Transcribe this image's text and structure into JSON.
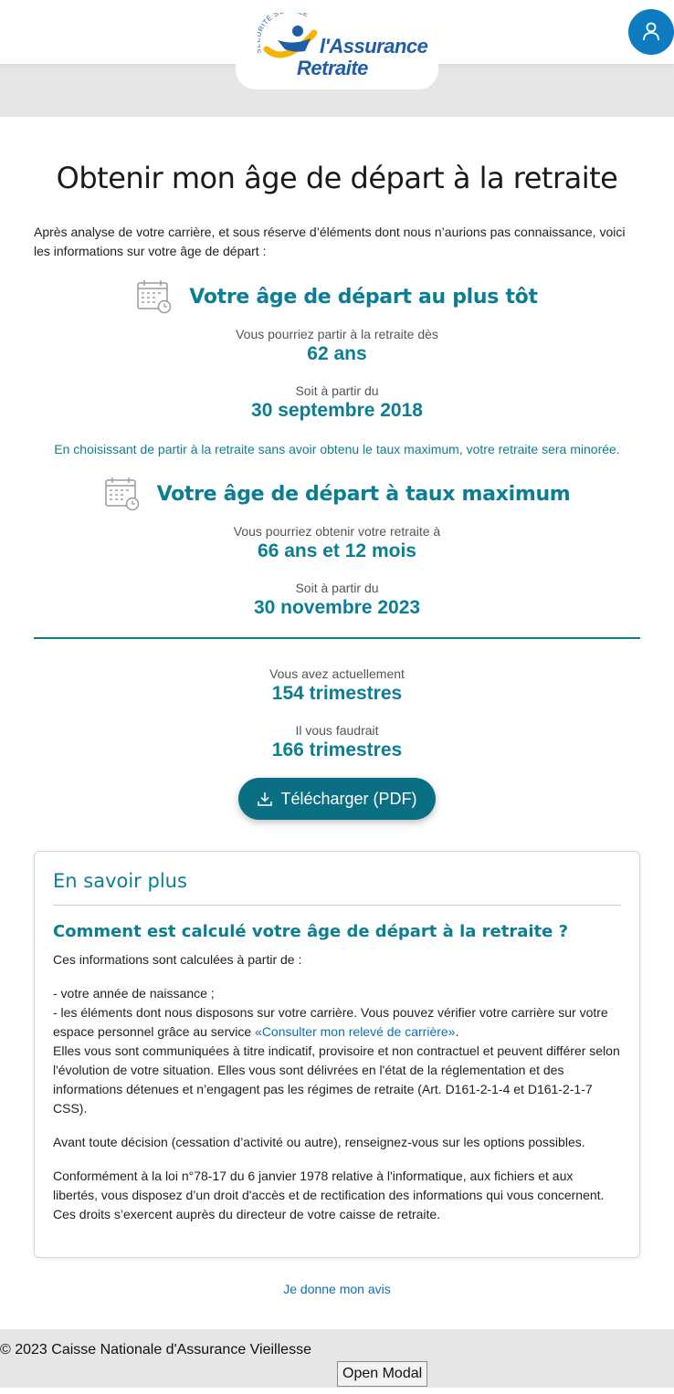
{
  "header": {
    "logo": {
      "secu_text": "SÉCURITÉ SOCIALE",
      "line1": "l'Assurance",
      "line2": "Retraite",
      "colors": {
        "blue": "#1f5da8",
        "yellow": "#f4b400"
      }
    },
    "user_icon": "user-icon",
    "accent": "#0f7bc1"
  },
  "main": {
    "title": "Obtenir mon âge de départ à la retraite",
    "intro": "Après analyse de votre carrière, et sous réserve d’éléments dont nous n’aurions pas connaissance, voici les informations sur votre âge de départ :",
    "earliest": {
      "heading": "Votre âge de départ au plus tôt",
      "age_label": "Vous pourriez partir à la retraite dès",
      "age_value": "62 ans",
      "date_label": "Soit à partir du",
      "date_value": "30 septembre 2018",
      "warning": "En choisissant de partir à la retraite sans avoir obtenu le taux maximum, votre retraite sera minorée."
    },
    "maximum": {
      "heading": "Votre âge de départ à taux maximum",
      "age_label": "Vous pourriez obtenir votre retraite à",
      "age_value": "66 ans et 12 mois",
      "date_label": "Soit à partir du",
      "date_value": "30 novembre 2023"
    },
    "quarters": {
      "current_label": "Vous avez actuellement",
      "current_value": "154 trimestres",
      "needed_label": "Il vous faudrait",
      "needed_value": "166 trimestres"
    },
    "download_label": "Télécharger (PDF)",
    "accent": "#0b7e94"
  },
  "more": {
    "title": "En savoir plus",
    "subtitle": "Comment est calculé votre âge de départ à la retraite ?",
    "p1": "Ces informations sont calculées à partir de :",
    "item1": "- votre année de naissance ;",
    "item2_before": "- les éléments dont nous disposons sur votre carrière. Vous pouvez vérifier votre carrière sur votre espace personnel grâce au service ",
    "item2_link": "«Consulter mon relevé de carrière»",
    "item2_after": ".",
    "p2": "Elles vous sont communiquées à titre indicatif, provisoire et non contractuel et peuvent différer selon l'évolution de votre situation. Elles vous sont délivrées en l'état de la réglementation et des informations détenues et n’engagent pas les régimes de retraite (Art. D161-2-1-4 et D161-2-1-7 CSS).",
    "p3": "Avant toute décision (cessation d’activité ou autre), renseignez-vous sur les options possibles.",
    "p4": "Conformément à la loi n°78-17 du 6 janvier 1978 relative à l'informatique, aux fichiers et aux libertés, vous disposez d’un droit d'accès et de rectification des informations qui vous concernent. Ces droits s’exercent auprès du directeur de votre caisse de retraite."
  },
  "feedback_link": "Je donne mon avis",
  "footer": {
    "copyright": "© 2023 Caisse Nationale d'Assurance Vieillesse",
    "modal_button": "Open Modal"
  }
}
